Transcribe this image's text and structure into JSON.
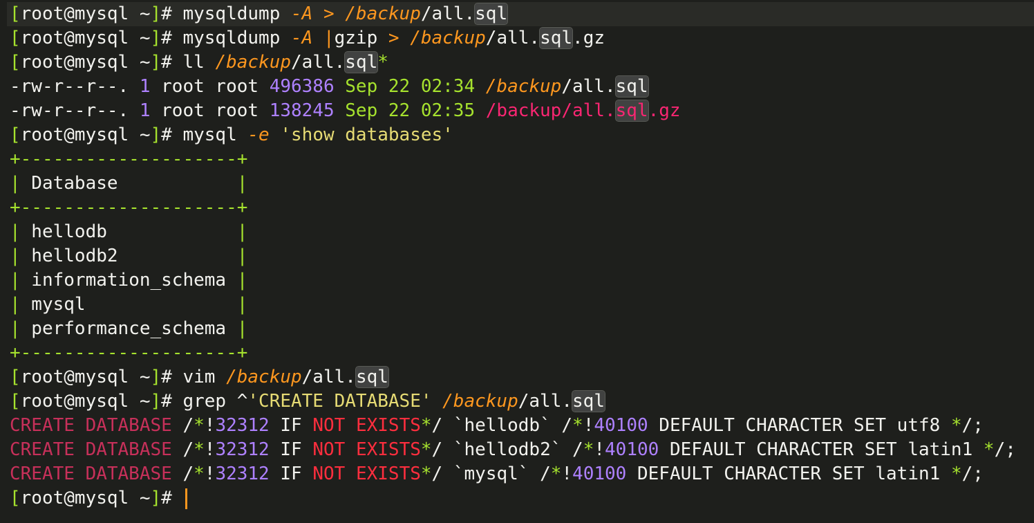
{
  "terminal": {
    "background": "#1e1f1c",
    "cursor_color": "#fd971f",
    "lines": [
      [
        [
          "[",
          "grn"
        ],
        [
          "root@mysql ~",
          "fg"
        ],
        [
          "]",
          "grn"
        ],
        [
          "# mysqldump ",
          "fg"
        ],
        [
          "-A",
          "orgi"
        ],
        [
          " > ",
          "org"
        ],
        [
          "/backup",
          "orgi"
        ],
        [
          "/all.",
          "fg"
        ],
        [
          "sql",
          "fg hl"
        ]
      ],
      [
        [
          "[",
          "grn"
        ],
        [
          "root@mysql ~",
          "fg"
        ],
        [
          "]",
          "grn"
        ],
        [
          "# mysqldump ",
          "fg"
        ],
        [
          "-A",
          "orgi"
        ],
        [
          " |",
          "org"
        ],
        [
          "gzip ",
          "fg"
        ],
        [
          "> ",
          "org"
        ],
        [
          "/backup",
          "orgi"
        ],
        [
          "/all.",
          "fg"
        ],
        [
          "sql",
          "fg hl"
        ],
        [
          ".gz",
          "fg"
        ]
      ],
      [
        [
          "[",
          "grn"
        ],
        [
          "root@mysql ~",
          "fg"
        ],
        [
          "]",
          "grn"
        ],
        [
          "# ll ",
          "fg"
        ],
        [
          "/backup",
          "orgi"
        ],
        [
          "/all.",
          "fg"
        ],
        [
          "sql",
          "fg hl"
        ],
        [
          "*",
          "grn"
        ]
      ],
      [
        [
          "-rw-r--r--. ",
          "fg"
        ],
        [
          "1",
          "pur"
        ],
        [
          " root root ",
          "fg"
        ],
        [
          "496386",
          "pur"
        ],
        [
          " Sep 22 02:34 ",
          "grn"
        ],
        [
          "/backup",
          "orgi"
        ],
        [
          "/all.",
          "fg"
        ],
        [
          "sql",
          "fg hl"
        ]
      ],
      [
        [
          "-rw-r--r--. ",
          "fg"
        ],
        [
          "1",
          "pur"
        ],
        [
          " root root ",
          "fg"
        ],
        [
          "138245",
          "pur"
        ],
        [
          " Sep 22 02:35 ",
          "grn"
        ],
        [
          "/backup/all.",
          "pink"
        ],
        [
          "sql",
          "pink hl"
        ],
        [
          ".gz",
          "pink"
        ]
      ],
      [
        [
          "[",
          "grn"
        ],
        [
          "root@mysql ~",
          "fg"
        ],
        [
          "]",
          "grn"
        ],
        [
          "# mysql ",
          "fg"
        ],
        [
          "-e",
          "orgi"
        ],
        [
          " 'show databases'",
          "yel"
        ]
      ],
      [
        [
          "+--------------------+",
          "grn"
        ]
      ],
      [
        [
          "|",
          "grn"
        ],
        [
          " Database           ",
          "fg"
        ],
        [
          "|",
          "grn"
        ]
      ],
      [
        [
          "+--------------------+",
          "grn"
        ]
      ],
      [
        [
          "|",
          "grn"
        ],
        [
          " hellodb            ",
          "fg"
        ],
        [
          "|",
          "grn"
        ]
      ],
      [
        [
          "|",
          "grn"
        ],
        [
          " hellodb2           ",
          "fg"
        ],
        [
          "|",
          "grn"
        ]
      ],
      [
        [
          "|",
          "grn"
        ],
        [
          " information_schema ",
          "fg"
        ],
        [
          "|",
          "grn"
        ]
      ],
      [
        [
          "|",
          "grn"
        ],
        [
          " mysql              ",
          "fg"
        ],
        [
          "|",
          "grn"
        ]
      ],
      [
        [
          "|",
          "grn"
        ],
        [
          " performance_schema ",
          "fg"
        ],
        [
          "|",
          "grn"
        ]
      ],
      [
        [
          "+--------------------+",
          "grn"
        ]
      ],
      [
        [
          "[",
          "grn"
        ],
        [
          "root@mysql ~",
          "fg"
        ],
        [
          "]",
          "grn"
        ],
        [
          "# vim ",
          "fg"
        ],
        [
          "/backup",
          "orgi"
        ],
        [
          "/all.",
          "fg"
        ],
        [
          "sql",
          "fg hl"
        ]
      ],
      [
        [
          "[",
          "grn"
        ],
        [
          "root@mysql ~",
          "fg"
        ],
        [
          "]",
          "grn"
        ],
        [
          "# grep ^",
          "fg"
        ],
        [
          "'CREATE DATABASE'",
          "yel"
        ],
        [
          " ",
          "fg"
        ],
        [
          "/backup",
          "orgi"
        ],
        [
          "/all.",
          "fg"
        ],
        [
          "sql",
          "fg hl"
        ]
      ],
      [
        [
          "CREATE DATABASE",
          "crim"
        ],
        [
          " /",
          "fg"
        ],
        [
          "*",
          "grn"
        ],
        [
          "!",
          "fg"
        ],
        [
          "32312",
          "pur"
        ],
        [
          " IF ",
          "fg"
        ],
        [
          "NOT EXISTS",
          "red"
        ],
        [
          "*",
          "grn"
        ],
        [
          "/ `hellodb` /",
          "fg"
        ],
        [
          "*",
          "grn"
        ],
        [
          "!",
          "fg"
        ],
        [
          "40100",
          "pur"
        ],
        [
          " DEFAULT CHARACTER SET utf8 ",
          "fg"
        ],
        [
          "*",
          "grn"
        ],
        [
          "/;",
          "fg"
        ]
      ],
      [
        [
          "CREATE DATABASE",
          "crim"
        ],
        [
          " /",
          "fg"
        ],
        [
          "*",
          "grn"
        ],
        [
          "!",
          "fg"
        ],
        [
          "32312",
          "pur"
        ],
        [
          " IF ",
          "fg"
        ],
        [
          "NOT EXISTS",
          "red"
        ],
        [
          "*",
          "grn"
        ],
        [
          "/ `hellodb2` /",
          "fg"
        ],
        [
          "*",
          "grn"
        ],
        [
          "!",
          "fg"
        ],
        [
          "40100",
          "pur"
        ],
        [
          " DEFAULT CHARACTER SET latin1 ",
          "fg"
        ],
        [
          "*",
          "grn"
        ],
        [
          "/;",
          "fg"
        ]
      ],
      [
        [
          "CREATE DATABASE",
          "crim"
        ],
        [
          " /",
          "fg"
        ],
        [
          "*",
          "grn"
        ],
        [
          "!",
          "fg"
        ],
        [
          "32312",
          "pur"
        ],
        [
          " IF ",
          "fg"
        ],
        [
          "NOT EXISTS",
          "red"
        ],
        [
          "*",
          "grn"
        ],
        [
          "/ `mysql` /",
          "fg"
        ],
        [
          "*",
          "grn"
        ],
        [
          "!",
          "fg"
        ],
        [
          "40100",
          "pur"
        ],
        [
          " DEFAULT CHARACTER SET latin1 ",
          "fg"
        ],
        [
          "*",
          "grn"
        ],
        [
          "/;",
          "fg"
        ]
      ],
      [
        [
          "[",
          "grn"
        ],
        [
          "root@mysql ~",
          "fg"
        ],
        [
          "]",
          "grn"
        ],
        [
          "# ",
          "fg"
        ]
      ]
    ]
  }
}
